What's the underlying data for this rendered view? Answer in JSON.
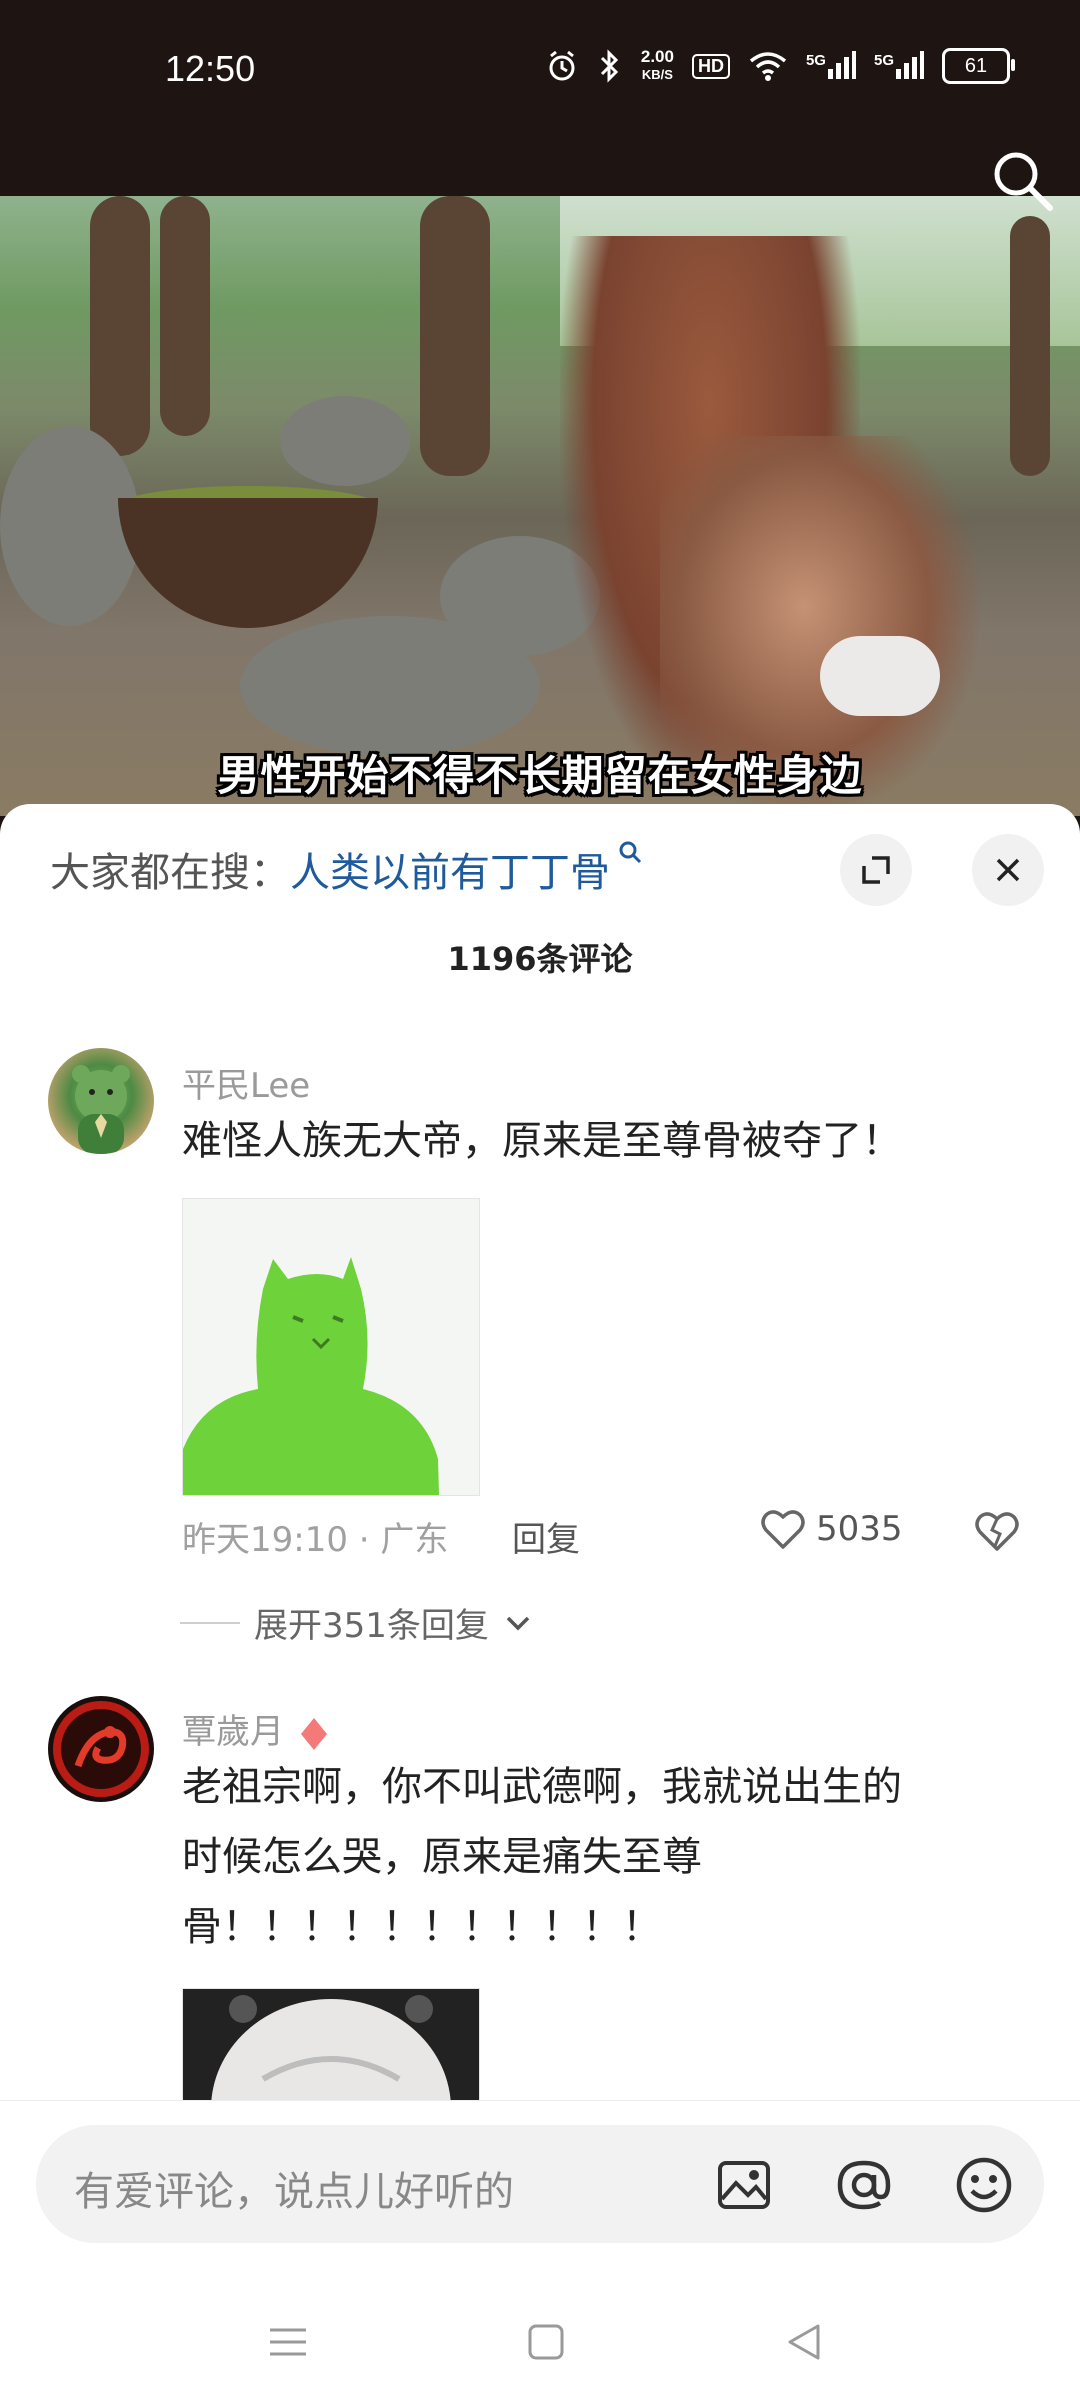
{
  "status_bar": {
    "time": "12:50",
    "net_speed_value": "2.00",
    "net_speed_unit": "KB/S",
    "hd_label": "HD",
    "network_1": "5G",
    "network_2": "5G",
    "battery": "61"
  },
  "video": {
    "subtitle": "男性开始不得不长期留在女性身边"
  },
  "comments_panel": {
    "trending_prefix": "大家都在搜：",
    "trending_query": "人类以前有丁丁骨",
    "comment_count": "1196条评论",
    "comments": [
      {
        "username": "平民Lee",
        "text": "难怪人族无大帝，原来是至尊骨被夺了！",
        "meta": "昨天19:10 · 广东",
        "reply_label": "回复",
        "likes": "5035",
        "expand_label": "展开351条回复"
      },
      {
        "username": "覃歲月",
        "text_lines": [
          "老祖宗啊，你不叫武德啊，我就说出生的",
          "时候怎么哭，原来是痛失至尊",
          "骨！！！！！！！！！！！"
        ]
      }
    ]
  },
  "input": {
    "placeholder": "有爱评论，说点儿好听的"
  },
  "icons": {
    "search": "search-icon",
    "expand": "expand-icon",
    "close": "close-icon",
    "heart": "heart-icon",
    "broken_heart": "broken-heart-icon",
    "image": "image-icon",
    "mention": "at-icon",
    "emoji": "emoji-icon",
    "menu": "menu-icon",
    "home": "home-icon",
    "back": "back-icon"
  },
  "colors": {
    "link": "#1f5a9c",
    "vip_badge": "#f47a7a"
  }
}
